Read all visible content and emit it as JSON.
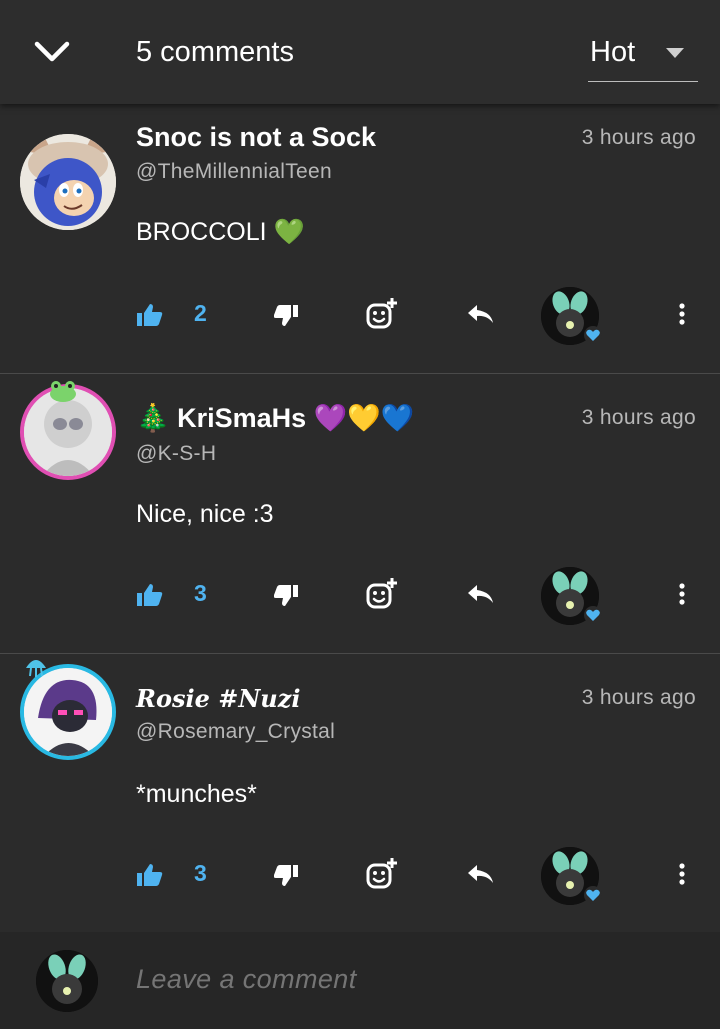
{
  "header": {
    "title": "5 comments",
    "sort_label": "Hot"
  },
  "comments": [
    {
      "name": "Snoc is not a Sock",
      "handle": "@TheMillennialTeen",
      "time": "3 hours ago",
      "text": "BROCCOLI 💚",
      "likes": "2"
    },
    {
      "name": "🎄 KriSmaHs 💜💛💙",
      "handle": "@K-S-H",
      "time": "3 hours ago",
      "text": "Nice, nice :3",
      "likes": "3"
    },
    {
      "name": "Rosie #Nuzi",
      "handle": "@Rosemary_Crystal",
      "time": "3 hours ago",
      "text": "*munches*",
      "likes": "3"
    }
  ],
  "footer": {
    "placeholder": "Leave a comment"
  },
  "colors": {
    "background": "#2b2b2b",
    "header": "#2d2d2d",
    "like_accent": "#4fb3f0",
    "secondary_text": "#b7b7b7"
  }
}
